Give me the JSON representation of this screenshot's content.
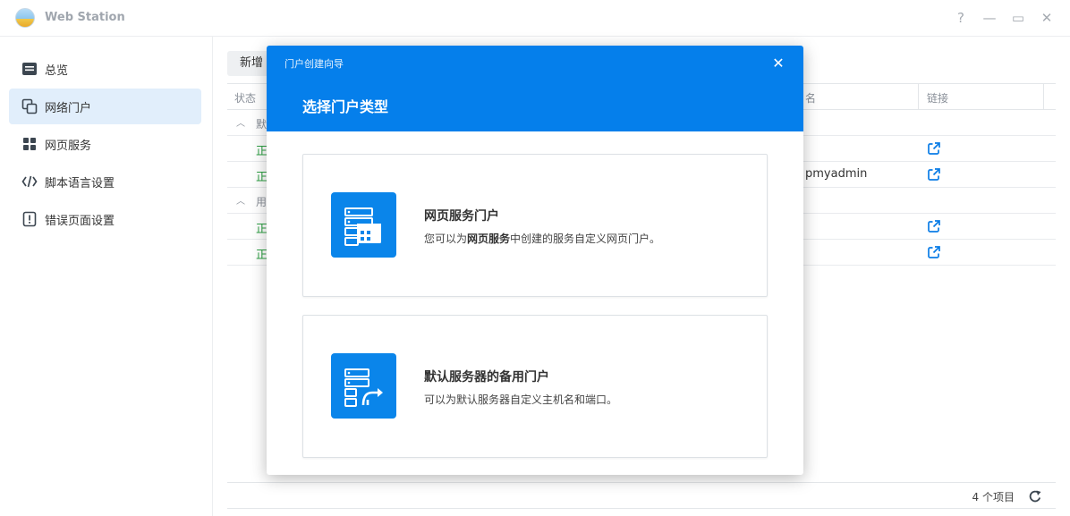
{
  "app": {
    "title": "Web Station",
    "controls": {
      "help": "?",
      "minimize": "—",
      "maximize": "▭",
      "close": "✕"
    }
  },
  "sidebar": {
    "items": [
      {
        "label": "总览",
        "icon": "overview-icon"
      },
      {
        "label": "网络门户",
        "icon": "web-portal-icon",
        "active": true
      },
      {
        "label": "网页服务",
        "icon": "web-service-icon"
      },
      {
        "label": "脚本语言设置",
        "icon": "code-icon"
      },
      {
        "label": "错误页面设置",
        "icon": "error-page-icon"
      }
    ]
  },
  "toolbar": {
    "add_label": "新增"
  },
  "table": {
    "headers": {
      "status": "状态",
      "name": "名",
      "link": "链接"
    },
    "groups": [
      {
        "label": "默",
        "rows": [
          {
            "status": "正",
            "name": ""
          },
          {
            "status": "正",
            "name": "pmyadmin"
          }
        ]
      },
      {
        "label": "用",
        "rows": [
          {
            "status": "正",
            "name": ""
          },
          {
            "status": "正",
            "name": ""
          }
        ]
      }
    ]
  },
  "footer": {
    "count": "4 个项目"
  },
  "modal": {
    "window_title": "门户创建向导",
    "step_title": "选择门户类型",
    "options": [
      {
        "title": "网页服务门户",
        "desc_prefix": "您可以为",
        "desc_bold": "网页服务",
        "desc_suffix": "中创建的服务自定义网页门户。",
        "icon": "web-service-portal-icon"
      },
      {
        "title": "默认服务器的备用门户",
        "desc_prefix": "可以为默认服务器自定义主机名和端口。",
        "desc_bold": "",
        "desc_suffix": "",
        "icon": "alternate-portal-icon"
      }
    ]
  },
  "colors": {
    "accent": "#057feb",
    "status_ok": "#2da043",
    "active_nav_bg": "#e1eefb"
  }
}
